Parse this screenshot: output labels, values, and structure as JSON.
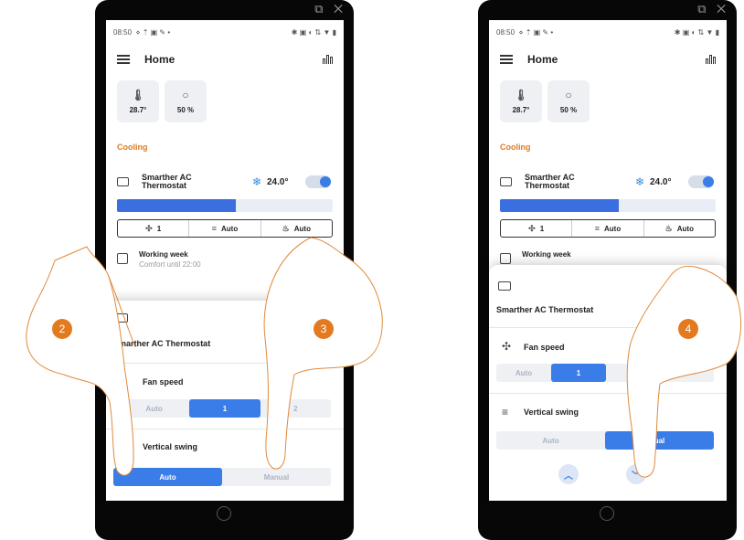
{
  "left": {
    "status": {
      "time": "08:50",
      "left_icons": "⋄ ⇡ ▣ ✎ •",
      "right_icons": "✱ ▣ ◐ ⇅ ▼ ▮"
    },
    "app": {
      "title": "Home"
    },
    "tiles": [
      {
        "icon": "thermometer-icon",
        "value": "28.7°"
      },
      {
        "icon": "humidity-drop-icon",
        "value": "50 %"
      }
    ],
    "section": "Cooling",
    "device": {
      "name": "Smarther AC Thermostat",
      "setpoint": "24.0°",
      "on": true,
      "progress": 0.55
    },
    "chips": [
      {
        "icon": "fan-icon",
        "label": "1"
      },
      {
        "icon": "swing-icon",
        "label": "Auto"
      },
      {
        "icon": "mode-icon",
        "label": "Auto"
      }
    ],
    "schedule": {
      "title": "Working week",
      "subtitle": "Comfort until 22:00"
    },
    "sheet": {
      "title": "Smarther AC Thermostat",
      "fan_label": "Fan speed",
      "fan_options": [
        "Auto",
        "1",
        "2"
      ],
      "fan_selected": "1",
      "swing_label": "Vertical swing",
      "swing_options": [
        "Auto",
        "Manual"
      ],
      "swing_selected": "Auto"
    },
    "steps": [
      "2",
      "3"
    ]
  },
  "right": {
    "status": {
      "time": "08:50",
      "left_icons": "⋄ ⇡ ▣ ✎ •",
      "right_icons": "✱ ▣ ◐ ⇅ ▼ ▮"
    },
    "app": {
      "title": "Home"
    },
    "tiles": [
      {
        "icon": "thermometer-icon",
        "value": "28.7°"
      },
      {
        "icon": "humidity-drop-icon",
        "value": "50 %"
      }
    ],
    "section": "Cooling",
    "device": {
      "name": "Smarther AC Thermostat",
      "setpoint": "24.0°",
      "on": true,
      "progress": 0.55
    },
    "chips": [
      {
        "icon": "fan-icon",
        "label": "1"
      },
      {
        "icon": "swing-icon",
        "label": "Auto"
      },
      {
        "icon": "mode-icon",
        "label": "Auto"
      }
    ],
    "schedule": {
      "title": "Working week"
    },
    "sheet": {
      "title": "Smarther AC Thermostat",
      "fan_label": "Fan speed",
      "fan_options": [
        "Auto",
        "1"
      ],
      "fan_selected": "1",
      "swing_label": "Vertical swing",
      "swing_options": [
        "Auto",
        "ual"
      ],
      "swing_selected": "ual"
    },
    "steps": [
      "4"
    ]
  },
  "window_controls": "⧉ ✕",
  "colors": {
    "accent": "#3a7de8",
    "step_badge": "#e47a20",
    "section": "#e07a1f",
    "phone": "#070707"
  }
}
